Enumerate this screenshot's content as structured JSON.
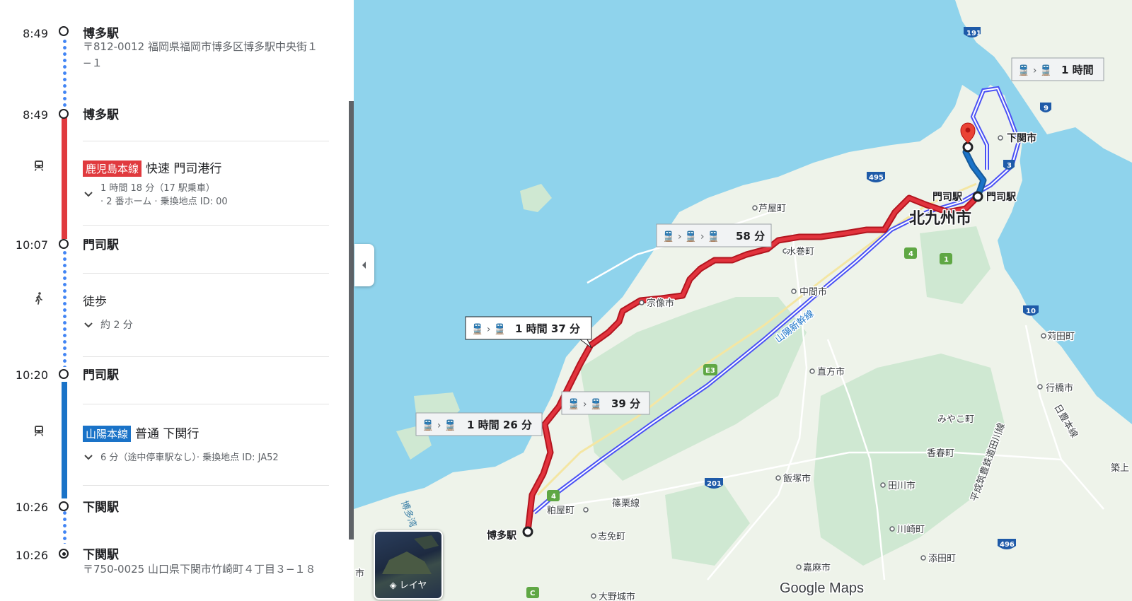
{
  "itinerary": {
    "origin": {
      "time": "8:49",
      "name": "博多駅",
      "address": "〒812-0012 福岡県福岡市博多区博多駅中央街１−１"
    },
    "board1": {
      "time": "8:49",
      "name": "博多駅"
    },
    "leg1": {
      "line": "鹿児島本線",
      "line_color": "#e03a3e",
      "service": "快速 門司港行",
      "duration": "1 時間 18 分（17 駅乗車）",
      "platform": "· 2 番ホーム · 乗換地点 ID: 00",
      "icon": "train-icon"
    },
    "arrive1": {
      "time": "10:07",
      "name": "門司駅"
    },
    "walk": {
      "label": "徒歩",
      "duration": "約 2 分",
      "icon": "walk-icon"
    },
    "board2": {
      "time": "10:20",
      "name": "門司駅"
    },
    "leg2": {
      "line": "山陽本線",
      "line_color": "#1a73c8",
      "service": "普通 下関行",
      "detail": "6 分（途中停車駅なし）· 乗換地点 ID: JA52",
      "icon": "train-icon"
    },
    "arrive2": {
      "time": "10:26",
      "name": "下関駅"
    },
    "destination": {
      "time": "10:26",
      "name": "下関駅",
      "address": "〒750-0025 山口県下関市竹崎町４丁目３−１８"
    }
  },
  "map": {
    "callouts": [
      {
        "text": "1 時間",
        "icon": "train-icon"
      },
      {
        "text": "58 分",
        "icon": "train-icon"
      },
      {
        "text": "1 時間 37 分",
        "icon": "train-icon"
      },
      {
        "text": "39 分",
        "icon": "train-icon"
      },
      {
        "text": "1 時間 26 分",
        "icon": "train-icon"
      }
    ],
    "labels": {
      "kitakyushu": "北九州市",
      "shimonoseki": "下関市",
      "moji1": "門司駅",
      "moji2": "門司駅",
      "hakata": "博多駅",
      "ashiya": "芦屋町",
      "mizumaki": "水巻町",
      "munakata": "宗像市",
      "nakama": "中間市",
      "nogata": "直方市",
      "kanda": "苅田町",
      "yukuhashi": "行橋市",
      "miyako": "みやこ町",
      "kawara": "香春町",
      "iizuka": "飯塚市",
      "tagawa": "田川市",
      "kasuya": "粕屋町",
      "shime": "志免町",
      "kawasaki": "川崎町",
      "soeda": "添田町",
      "kama": "嘉麻市",
      "onojo": "大野城市",
      "chikujo": "築上",
      "sasaguri": "篠栗線",
      "sanyo_shinkansen": "山陽新幹線",
      "hakata_bay": "博多湾",
      "heisei": "平成筑豊鉄道田川線",
      "nippo": "日豊本線",
      "shi": "市",
      "logo": "Google Maps"
    },
    "shields": [
      "191",
      "9",
      "3",
      "495",
      "4",
      "1",
      "10",
      "E3",
      "201",
      "4",
      "496",
      "C"
    ],
    "layer_label": "レイヤ",
    "colors": {
      "water": "#8fd3ec",
      "land": "#eef3ea",
      "green": "#cfe8d2",
      "route_red": "#d6222d",
      "route_blue": "#4a51f5",
      "route_walk": "#1a73c8"
    }
  }
}
